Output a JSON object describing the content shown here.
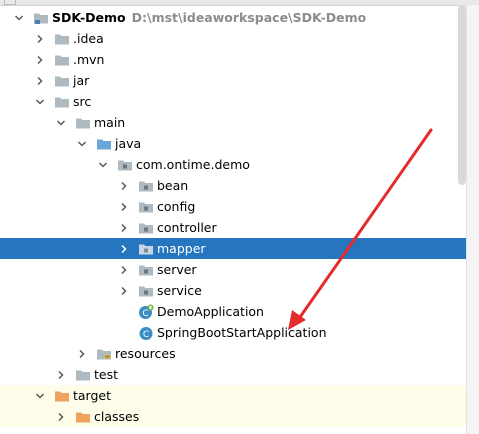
{
  "project": {
    "name": "SDK-Demo",
    "path": "D:\\mst\\ideaworkspace\\SDK-Demo"
  },
  "tree": [
    {
      "label": "SDK-Demo",
      "depth": 0,
      "expanded": true,
      "icon": "module-icon",
      "bold": true,
      "path": "D:\\mst\\ideaworkspace\\SDK-Demo"
    },
    {
      "label": ".idea",
      "depth": 1,
      "expanded": false,
      "icon": "folder-icon"
    },
    {
      "label": ".mvn",
      "depth": 1,
      "expanded": false,
      "icon": "folder-icon"
    },
    {
      "label": "jar",
      "depth": 1,
      "expanded": false,
      "icon": "folder-icon"
    },
    {
      "label": "src",
      "depth": 1,
      "expanded": true,
      "icon": "folder-icon"
    },
    {
      "label": "main",
      "depth": 2,
      "expanded": true,
      "icon": "folder-icon"
    },
    {
      "label": "java",
      "depth": 3,
      "expanded": true,
      "icon": "source-folder-icon"
    },
    {
      "label": "com.ontime.demo",
      "depth": 4,
      "expanded": true,
      "icon": "package-icon"
    },
    {
      "label": "bean",
      "depth": 5,
      "expanded": false,
      "icon": "package-icon"
    },
    {
      "label": "config",
      "depth": 5,
      "expanded": false,
      "icon": "package-icon"
    },
    {
      "label": "controller",
      "depth": 5,
      "expanded": false,
      "icon": "package-icon"
    },
    {
      "label": "mapper",
      "depth": 5,
      "expanded": false,
      "icon": "package-icon",
      "selected": true
    },
    {
      "label": "server",
      "depth": 5,
      "expanded": false,
      "icon": "package-icon"
    },
    {
      "label": "service",
      "depth": 5,
      "expanded": false,
      "icon": "package-icon"
    },
    {
      "label": "DemoApplication",
      "depth": 5,
      "leaf": true,
      "icon": "spring-boot-class-icon"
    },
    {
      "label": "SpringBootStartApplication",
      "depth": 5,
      "leaf": true,
      "icon": "class-icon"
    },
    {
      "label": "resources",
      "depth": 3,
      "expanded": false,
      "icon": "resources-folder-icon"
    },
    {
      "label": "test",
      "depth": 2,
      "expanded": false,
      "icon": "folder-icon"
    },
    {
      "label": "target",
      "depth": 1,
      "expanded": true,
      "icon": "excluded-folder-icon",
      "tint": true
    },
    {
      "label": "classes",
      "depth": 2,
      "expanded": false,
      "icon": "excluded-folder-icon",
      "tint": true
    }
  ],
  "colors": {
    "selection": "#2675bf",
    "folder": "#aeb9c0",
    "source_folder": "#6ba7d9",
    "excluded_folder": "#f0a35f",
    "annotation_arrow": "#e52b2b"
  }
}
